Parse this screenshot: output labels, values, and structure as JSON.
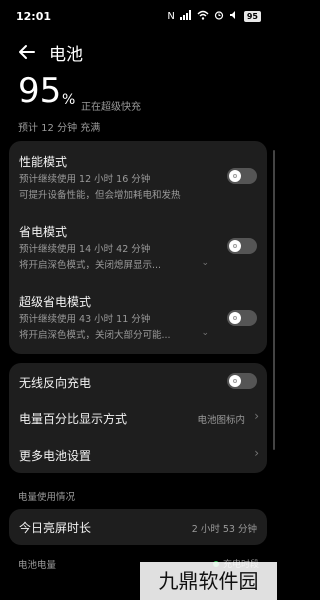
{
  "status_bar": {
    "time": "12:01",
    "icons": [
      "nfc-icon",
      "signal-icon",
      "wifi-icon",
      "alarm-icon",
      "sound-icon"
    ],
    "battery_badge": "95"
  },
  "header": {
    "title": "电池"
  },
  "battery": {
    "percent": "95",
    "percent_sign": "%",
    "charging_text": "正在超级快充",
    "eta_text": "预计 12 分钟 充满"
  },
  "modes": [
    {
      "title": "性能模式",
      "line1": "预计继续使用 12 小时 16 分钟",
      "line2": "可提升设备性能，但会增加耗电和发热",
      "enabled": false,
      "expandable": false
    },
    {
      "title": "省电模式",
      "line1": "预计继续使用 14 小时 42 分钟",
      "line2": "将开启深色模式，关闭熄屏显示...",
      "enabled": false,
      "expandable": true
    },
    {
      "title": "超级省电模式",
      "line1": "预计继续使用 43 小时 11 分钟",
      "line2": "将开启深色模式，关闭大部分可能...",
      "enabled": false,
      "expandable": true
    }
  ],
  "settings": {
    "wireless_reverse": {
      "label": "无线反向充电",
      "enabled": false
    },
    "percent_display": {
      "label": "电量百分比显示方式",
      "value": "电池图标内"
    },
    "more": {
      "label": "更多电池设置"
    }
  },
  "usage": {
    "section_label": "电量使用情况",
    "screen_time_label": "今日亮屏时长",
    "screen_time_value": "2 小时 53 分钟",
    "battery_level_label": "电池电量",
    "legend_label": "充电时段",
    "legend_color": "#3fbf5c"
  },
  "watermark": "九鼎软件园"
}
